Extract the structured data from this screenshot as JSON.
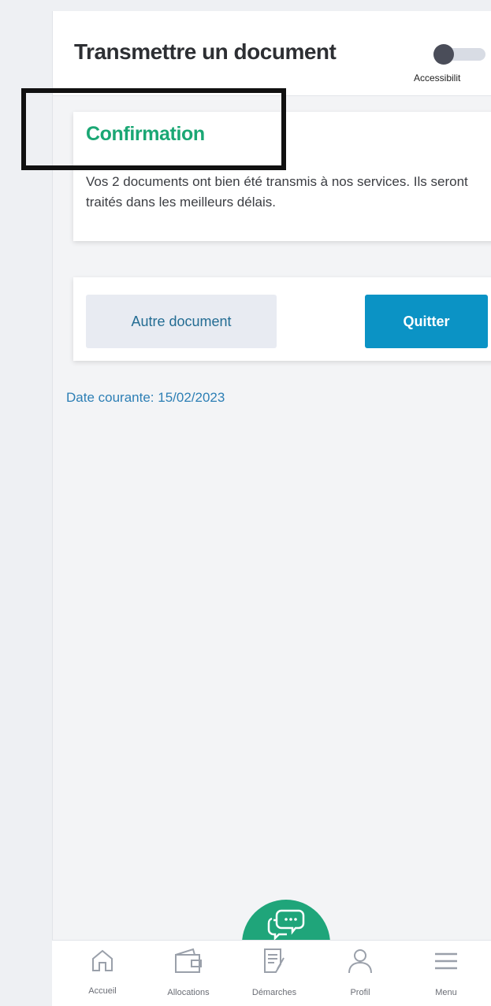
{
  "header": {
    "title": "Transmettre un document",
    "accessibility_label": "Accessibilit"
  },
  "confirmation": {
    "title": "Confirmation",
    "message": "Vos 2 documents ont bien été transmis à nos services. Ils seront traités dans les meilleurs délais."
  },
  "actions": {
    "other_label": "Autre document",
    "quit_label": "Quitter"
  },
  "date_line": "Date courante: 15/02/2023",
  "nav": {
    "items": [
      {
        "label": "Accueil",
        "icon": "home-icon"
      },
      {
        "label": "Allocations",
        "icon": "wallet-icon"
      },
      {
        "label": "Démarches",
        "icon": "document-edit-icon"
      },
      {
        "label": "Profil",
        "icon": "user-icon"
      },
      {
        "label": "Menu",
        "icon": "menu-icon"
      }
    ]
  },
  "colors": {
    "accent_green": "#1aa774",
    "primary_blue": "#0b93c5",
    "link_blue": "#2d7fb5"
  }
}
